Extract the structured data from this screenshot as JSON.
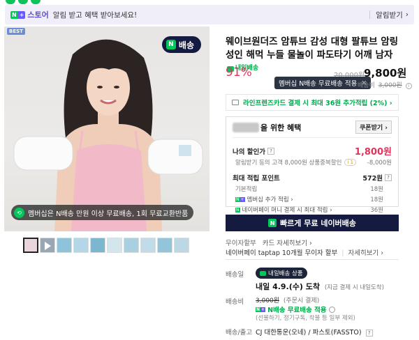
{
  "alert_bar": {
    "store_label": "스토어",
    "message": "알림 받고 혜택 받아보세요!",
    "subscribe_label": "알림받기",
    "chevron": "›"
  },
  "gallery": {
    "best_badge": "BEST",
    "nship_badge": "배송",
    "member_banner": "멤버십은 N배송 만원 이상 무료배송, 1회 무료교환반품",
    "thumbnail_count": 10
  },
  "product": {
    "title": "웨이브원더즈 암튜브 감성 대형 팔튜브 암링 성인 해먹 누들 물놀이 파도타기 어깨 남자",
    "tomorrow_tag": "내일배송",
    "discount": "91%",
    "original_price": "20,000원",
    "price": "9,800원",
    "tooltip": "멤버십 N배송 무료배송 적용",
    "tooltip_close": "✕",
    "shipping_note_label": "배송비",
    "shipping_note_fee": "3,000원",
    "card_offer": "라인프렌즈카드 결제 시 최대 36원 추가적립 (2%) ›"
  },
  "benefits": {
    "title": "을 위한 혜택",
    "coupon_button": "쿠폰받기 ›",
    "my_discount_label": "나의 할인가",
    "my_discount_value": "1,800원",
    "alert_discount_label": "알림받기 동의 고객 8,000원 상품중복할인",
    "alert_discount_tag": "i 1",
    "alert_discount_value": "-8,000원",
    "points_label": "최대 적립 포인트",
    "points_value": "572원",
    "basic_label": "기본적립",
    "basic_value": "18원",
    "membership_label": "멤버십 추가 적립 ›",
    "membership_value": "18원",
    "money_label": "네이버페이 머니 결제 시 최대 적립 ›",
    "money_value": "36원"
  },
  "buy_button": "빠르게 무료 네이버배송",
  "installment": {
    "label": "무이자할부",
    "card_link": "카드 자세히보기 ›",
    "taptap": "네이버페이 taptap 10개월 무이자 할부",
    "taptap_link": "자세히보기 ›"
  },
  "delivery": {
    "date_label": "배송일",
    "tomorrow_pill": "내일배송 상품",
    "date": "내일 4.9.(수) 도착",
    "date_note": "(지금 결제 시 내일도착)",
    "fee_label": "배송비",
    "fee_original": "3,000원",
    "fee_note": "(주문시 결제)",
    "free_text": "N배송 무료배송 적용",
    "free_sub": "(선물하기, 정기구독, 착불 등 일부 제외)",
    "courier_label": "배송/출고",
    "courier": "CJ 대한통운(오네) / 파스토(FASSTO)"
  }
}
